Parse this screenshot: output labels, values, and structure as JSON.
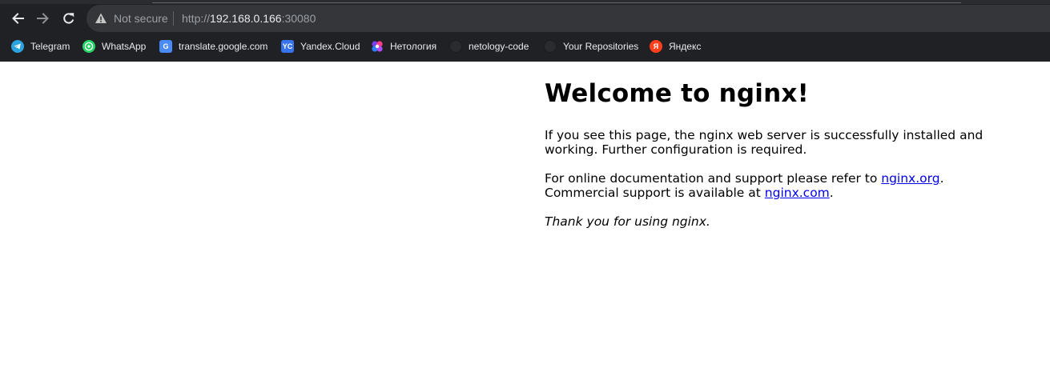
{
  "browser": {
    "security_label": "Not secure",
    "url": {
      "scheme": "http://",
      "host": "192.168.0.166",
      "port": ":30080"
    },
    "icons": {
      "back": "arrow-left-icon",
      "forward": "arrow-right-icon",
      "reload": "reload-icon",
      "security": "warning-triangle-icon"
    },
    "bookmarks": [
      {
        "label": "Telegram",
        "icon": "telegram-icon"
      },
      {
        "label": "WhatsApp",
        "icon": "whatsapp-icon"
      },
      {
        "label": "translate.google.com",
        "icon": "google-translate-icon"
      },
      {
        "label": "Yandex.Cloud",
        "icon": "yandex-cloud-icon",
        "icon_text": "YC"
      },
      {
        "label": "Нетология",
        "icon": "netology-icon"
      },
      {
        "label": "netology-code",
        "icon": "github-icon"
      },
      {
        "label": "Your Repositories",
        "icon": "github-icon"
      },
      {
        "label": "Яндекс",
        "icon": "yandex-icon",
        "icon_text": "Я"
      }
    ],
    "colors": {
      "toolbar_bg": "#202124",
      "omnibox_bg": "#35363a",
      "text": "#e8eaed",
      "muted_text": "#9aa0a6"
    }
  },
  "page": {
    "heading": "Welcome to nginx!",
    "paragraph1": "If you see this page, the nginx web server is successfully installed and working. Further configuration is required.",
    "paragraph2": {
      "text1": "For online documentation and support please refer to ",
      "link1": "nginx.org",
      "text2": ".",
      "text3": "Commercial support is available at ",
      "link2": "nginx.com",
      "text4": "."
    },
    "paragraph3": "Thank you for using nginx.",
    "colors": {
      "link": "#0000ee",
      "text": "#000000",
      "background": "#ffffff"
    }
  }
}
